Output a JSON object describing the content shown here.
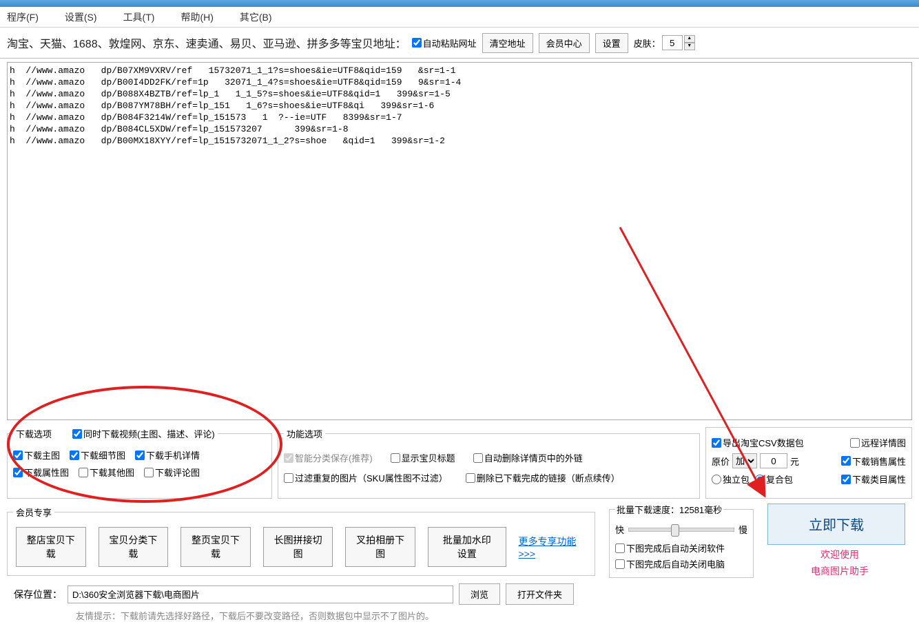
{
  "menu": [
    "程序(F)",
    "设置(S)",
    "工具(T)",
    "帮助(H)",
    "其它(B)"
  ],
  "topbar": {
    "label": "淘宝、天猫、1688、敦煌网、京东、速卖通、易贝、亚马逊、拼多多等宝贝地址：",
    "auto_paste": "自动粘贴网址",
    "clear": "清空地址",
    "member": "会员中心",
    "settings": "设置",
    "skin_label": "皮肤：",
    "skin_val": "5"
  },
  "urls": [
    {
      "a": "h",
      "b": "//www.amazo",
      "c": "dp/B07XM9VXRV/ref",
      "d": "15732071_1_1?s=shoes&ie=UTF8&qid=159",
      "e": "&sr=1-1"
    },
    {
      "a": "h",
      "b": "//www.amazo",
      "c": "dp/B00I4DD2FK/ref=1p",
      "d": "32071_1_4?s=shoes&ie=UTF8&qid=159",
      "e": "9&sr=1-4"
    },
    {
      "a": "h",
      "b": "//www.amazo",
      "c": "dp/B088X4BZTB/ref=lp_1",
      "d": "1_1_5?s=shoes&ie=UTF8&qid=1",
      "e": "399&sr=1-5"
    },
    {
      "a": "h",
      "b": "//www.amazo",
      "c": "dp/B087YM78BH/ref=lp_151",
      "d": "1_6?s=shoes&ie=UTF8&qi",
      "e": "399&sr=1-6"
    },
    {
      "a": "h",
      "b": "//www.amazo",
      "c": "dp/B084F3214W/ref=lp_151573",
      "d": "1  ?--ie=UTF",
      "e": "8399&sr=1-7"
    },
    {
      "a": "h",
      "b": "//www.amazo",
      "c": "dp/B084CL5XDW/ref=lp_151573207",
      "d": "",
      "e": "399&sr=1-8"
    },
    {
      "a": "h",
      "b": "//www.amazo",
      "c": "dp/B00MX18XYY/ref=lp_1515732071_1_2?s=shoe",
      "d": "&qid=1",
      "e": "399&sr=1-2"
    }
  ],
  "dl": {
    "legend": "下载选项",
    "video": "同时下载视频(主图、描述、评论)",
    "main": "下载主图",
    "detail": "下载细节图",
    "mobile": "下载手机详情",
    "attr": "下载属性图",
    "other": "下载其他图",
    "review": "下载评论图"
  },
  "fn": {
    "legend": "功能选项",
    "smart": "智能分类保存(推荐)",
    "title": "显示宝贝标题",
    "autodel": "自动删除详情页中的外链",
    "filter": "过滤重复的图片（SKU属性图不过滤）",
    "del_done": "删除已下载完成的链接（断点续传）"
  },
  "rt": {
    "export": "导出淘宝CSV数据包",
    "remote": "远程详情图",
    "price_lbl": "原价",
    "price_op": "加",
    "price_val": "0",
    "price_unit": "元",
    "sale_attr": "下载销售属性",
    "pkg_single": "独立包",
    "pkg_combo": "复合包",
    "cat_attr": "下载类目属性"
  },
  "member": {
    "legend": "会员专享",
    "b1": "整店宝贝下载",
    "b2": "宝贝分类下载",
    "b3": "整页宝贝下载",
    "b4": "长图拼接切图",
    "b5": "叉拍相册下图",
    "b6": "批量加水印设置",
    "more": "更多专享功能>>>"
  },
  "speed": {
    "legend_a": "批量下载速度：",
    "legend_b": "12581毫秒",
    "fast": "快",
    "slow": "慢",
    "close_soft": "下图完成后自动关闭软件",
    "close_pc": "下图完成后自动关闭电脑"
  },
  "download_btn": "立即下载",
  "welcome1": "欢迎使用",
  "welcome2": "电商图片助手",
  "save": {
    "label": "保存位置：",
    "path": "D:\\360安全浏览器下载\\电商图片",
    "browse": "浏览",
    "open": "打开文件夹"
  },
  "tip": "友情提示：下载前请先选择好路径，下载后不要改变路径，否则数据包中显示不了图片的。"
}
